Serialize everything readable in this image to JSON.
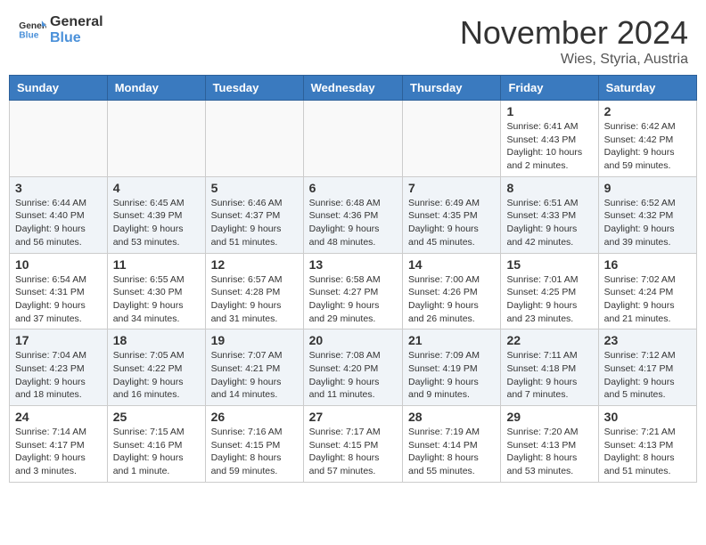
{
  "header": {
    "logo_text_general": "General",
    "logo_text_blue": "Blue",
    "month_title": "November 2024",
    "location": "Wies, Styria, Austria"
  },
  "days_of_week": [
    "Sunday",
    "Monday",
    "Tuesday",
    "Wednesday",
    "Thursday",
    "Friday",
    "Saturday"
  ],
  "weeks": [
    [
      {
        "day": "",
        "empty": true
      },
      {
        "day": "",
        "empty": true
      },
      {
        "day": "",
        "empty": true
      },
      {
        "day": "",
        "empty": true
      },
      {
        "day": "",
        "empty": true
      },
      {
        "day": "1",
        "sunrise": "Sunrise: 6:41 AM",
        "sunset": "Sunset: 4:43 PM",
        "daylight": "Daylight: 10 hours and 2 minutes."
      },
      {
        "day": "2",
        "sunrise": "Sunrise: 6:42 AM",
        "sunset": "Sunset: 4:42 PM",
        "daylight": "Daylight: 9 hours and 59 minutes."
      }
    ],
    [
      {
        "day": "3",
        "sunrise": "Sunrise: 6:44 AM",
        "sunset": "Sunset: 4:40 PM",
        "daylight": "Daylight: 9 hours and 56 minutes."
      },
      {
        "day": "4",
        "sunrise": "Sunrise: 6:45 AM",
        "sunset": "Sunset: 4:39 PM",
        "daylight": "Daylight: 9 hours and 53 minutes."
      },
      {
        "day": "5",
        "sunrise": "Sunrise: 6:46 AM",
        "sunset": "Sunset: 4:37 PM",
        "daylight": "Daylight: 9 hours and 51 minutes."
      },
      {
        "day": "6",
        "sunrise": "Sunrise: 6:48 AM",
        "sunset": "Sunset: 4:36 PM",
        "daylight": "Daylight: 9 hours and 48 minutes."
      },
      {
        "day": "7",
        "sunrise": "Sunrise: 6:49 AM",
        "sunset": "Sunset: 4:35 PM",
        "daylight": "Daylight: 9 hours and 45 minutes."
      },
      {
        "day": "8",
        "sunrise": "Sunrise: 6:51 AM",
        "sunset": "Sunset: 4:33 PM",
        "daylight": "Daylight: 9 hours and 42 minutes."
      },
      {
        "day": "9",
        "sunrise": "Sunrise: 6:52 AM",
        "sunset": "Sunset: 4:32 PM",
        "daylight": "Daylight: 9 hours and 39 minutes."
      }
    ],
    [
      {
        "day": "10",
        "sunrise": "Sunrise: 6:54 AM",
        "sunset": "Sunset: 4:31 PM",
        "daylight": "Daylight: 9 hours and 37 minutes."
      },
      {
        "day": "11",
        "sunrise": "Sunrise: 6:55 AM",
        "sunset": "Sunset: 4:30 PM",
        "daylight": "Daylight: 9 hours and 34 minutes."
      },
      {
        "day": "12",
        "sunrise": "Sunrise: 6:57 AM",
        "sunset": "Sunset: 4:28 PM",
        "daylight": "Daylight: 9 hours and 31 minutes."
      },
      {
        "day": "13",
        "sunrise": "Sunrise: 6:58 AM",
        "sunset": "Sunset: 4:27 PM",
        "daylight": "Daylight: 9 hours and 29 minutes."
      },
      {
        "day": "14",
        "sunrise": "Sunrise: 7:00 AM",
        "sunset": "Sunset: 4:26 PM",
        "daylight": "Daylight: 9 hours and 26 minutes."
      },
      {
        "day": "15",
        "sunrise": "Sunrise: 7:01 AM",
        "sunset": "Sunset: 4:25 PM",
        "daylight": "Daylight: 9 hours and 23 minutes."
      },
      {
        "day": "16",
        "sunrise": "Sunrise: 7:02 AM",
        "sunset": "Sunset: 4:24 PM",
        "daylight": "Daylight: 9 hours and 21 minutes."
      }
    ],
    [
      {
        "day": "17",
        "sunrise": "Sunrise: 7:04 AM",
        "sunset": "Sunset: 4:23 PM",
        "daylight": "Daylight: 9 hours and 18 minutes."
      },
      {
        "day": "18",
        "sunrise": "Sunrise: 7:05 AM",
        "sunset": "Sunset: 4:22 PM",
        "daylight": "Daylight: 9 hours and 16 minutes."
      },
      {
        "day": "19",
        "sunrise": "Sunrise: 7:07 AM",
        "sunset": "Sunset: 4:21 PM",
        "daylight": "Daylight: 9 hours and 14 minutes."
      },
      {
        "day": "20",
        "sunrise": "Sunrise: 7:08 AM",
        "sunset": "Sunset: 4:20 PM",
        "daylight": "Daylight: 9 hours and 11 minutes."
      },
      {
        "day": "21",
        "sunrise": "Sunrise: 7:09 AM",
        "sunset": "Sunset: 4:19 PM",
        "daylight": "Daylight: 9 hours and 9 minutes."
      },
      {
        "day": "22",
        "sunrise": "Sunrise: 7:11 AM",
        "sunset": "Sunset: 4:18 PM",
        "daylight": "Daylight: 9 hours and 7 minutes."
      },
      {
        "day": "23",
        "sunrise": "Sunrise: 7:12 AM",
        "sunset": "Sunset: 4:17 PM",
        "daylight": "Daylight: 9 hours and 5 minutes."
      }
    ],
    [
      {
        "day": "24",
        "sunrise": "Sunrise: 7:14 AM",
        "sunset": "Sunset: 4:17 PM",
        "daylight": "Daylight: 9 hours and 3 minutes."
      },
      {
        "day": "25",
        "sunrise": "Sunrise: 7:15 AM",
        "sunset": "Sunset: 4:16 PM",
        "daylight": "Daylight: 9 hours and 1 minute."
      },
      {
        "day": "26",
        "sunrise": "Sunrise: 7:16 AM",
        "sunset": "Sunset: 4:15 PM",
        "daylight": "Daylight: 8 hours and 59 minutes."
      },
      {
        "day": "27",
        "sunrise": "Sunrise: 7:17 AM",
        "sunset": "Sunset: 4:15 PM",
        "daylight": "Daylight: 8 hours and 57 minutes."
      },
      {
        "day": "28",
        "sunrise": "Sunrise: 7:19 AM",
        "sunset": "Sunset: 4:14 PM",
        "daylight": "Daylight: 8 hours and 55 minutes."
      },
      {
        "day": "29",
        "sunrise": "Sunrise: 7:20 AM",
        "sunset": "Sunset: 4:13 PM",
        "daylight": "Daylight: 8 hours and 53 minutes."
      },
      {
        "day": "30",
        "sunrise": "Sunrise: 7:21 AM",
        "sunset": "Sunset: 4:13 PM",
        "daylight": "Daylight: 8 hours and 51 minutes."
      }
    ]
  ]
}
